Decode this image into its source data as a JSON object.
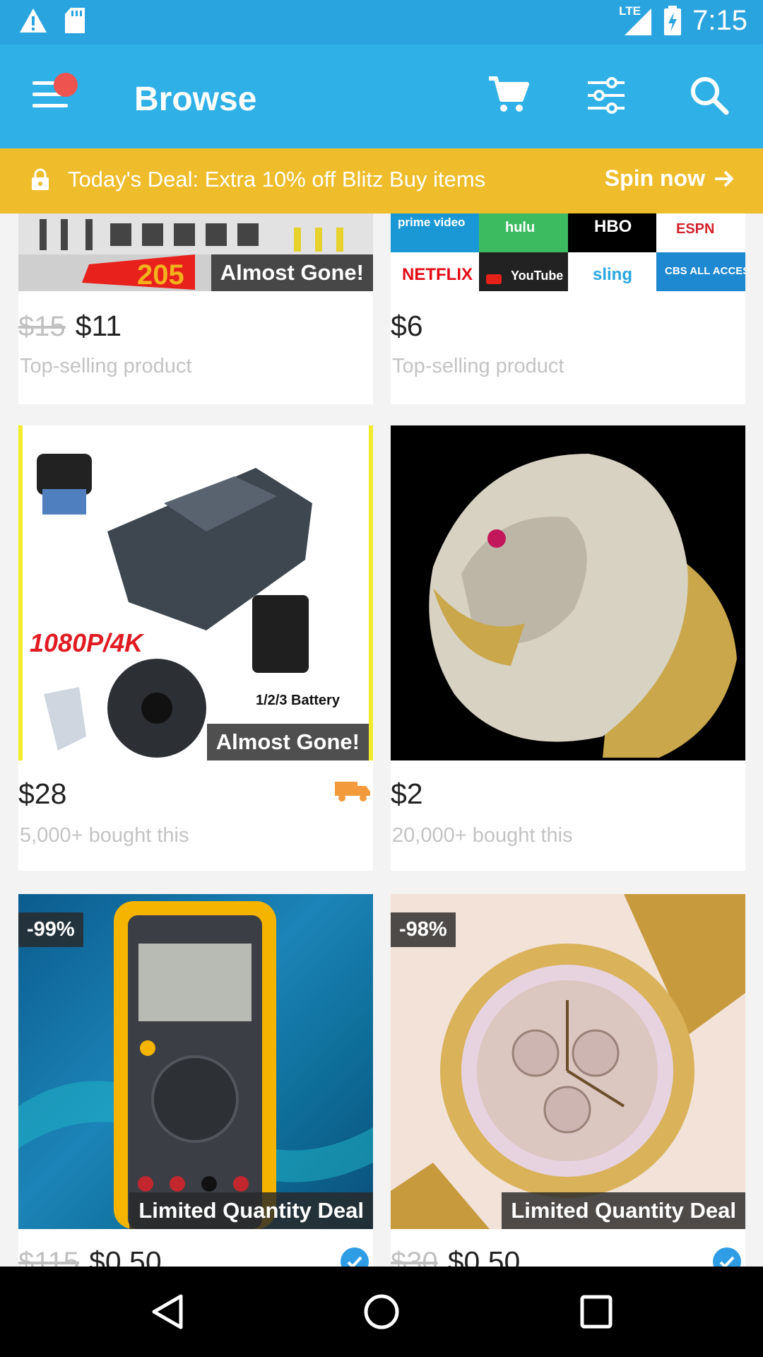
{
  "status_bar": {
    "network": "LTE",
    "time": "7:15",
    "icons": [
      "alert-icon",
      "sd-card-icon",
      "signal-icon",
      "battery-charging-icon"
    ]
  },
  "app_bar": {
    "title": "Browse",
    "icons": [
      "menu-icon",
      "cart-icon",
      "filter-icon",
      "search-icon"
    ],
    "notification_dot_color": "#ef5350",
    "background_color": "#2fb0e6"
  },
  "deal_banner": {
    "text": "Today's Deal: Extra 10% off Blitz Buy items",
    "action_label": "Spin now",
    "background_color": "#efbd2c"
  },
  "products": [
    {
      "image": "tool-set-image",
      "image_text": "205",
      "badge": "Almost Gone!",
      "old_price": "$15",
      "price": "$11",
      "subtitle": "Top-selling product"
    },
    {
      "image": "streaming-services-image",
      "image_labels": [
        "prime video",
        "hulu",
        "HBO",
        "ESPN",
        "NETFLIX",
        "YouTube",
        "sling",
        "CBS ALL ACCESS"
      ],
      "price": "$6",
      "subtitle": "Top-selling product"
    },
    {
      "image": "drone-image",
      "image_labels": [
        "1080P/4K",
        "1/2/3 Battery"
      ],
      "badge": "Almost Gone!",
      "price": "$28",
      "subtitle": "5,000+ bought this",
      "icon": "truck-icon"
    },
    {
      "image": "lion-ring-image",
      "price": "$2",
      "subtitle": "20,000+ bought this"
    },
    {
      "image": "multimeter-image",
      "discount": "-99%",
      "badge": "Limited Quantity Deal",
      "old_price": "$115",
      "price": "$0.50",
      "icon": "verified-icon"
    },
    {
      "image": "watch-image",
      "discount": "-98%",
      "badge": "Limited Quantity Deal",
      "old_price": "$30",
      "price": "$0.50",
      "icon": "verified-icon"
    }
  ],
  "nav_bar": {
    "icons": [
      "back-icon",
      "home-icon",
      "recents-icon"
    ]
  }
}
